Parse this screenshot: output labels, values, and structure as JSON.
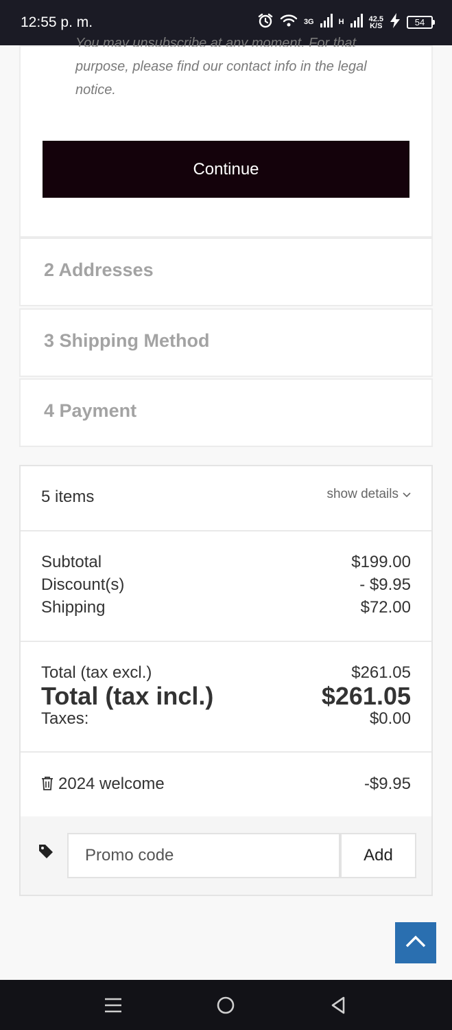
{
  "status_bar": {
    "time": "12:55 p. m.",
    "network_3g": "3G",
    "network_h": "H",
    "speed_value": "42.5",
    "speed_unit": "K/S",
    "battery": "54"
  },
  "consent": {
    "line_partial": "You may unsubscribe at any moment. For that",
    "line2": "purpose, please find our contact info in the legal",
    "line3": "notice.",
    "continue_label": "Continue"
  },
  "steps": [
    {
      "label": "2 Addresses"
    },
    {
      "label": "3 Shipping Method"
    },
    {
      "label": "4 Payment"
    }
  ],
  "cart": {
    "items_count": "5 items",
    "show_details": "show details",
    "subtotal_label": "Subtotal",
    "subtotal_value": "$199.00",
    "discount_label": "Discount(s)",
    "discount_value": "- $9.95",
    "shipping_label": "Shipping",
    "shipping_value": "$72.00",
    "total_excl_label": "Total (tax excl.)",
    "total_excl_value": "$261.05",
    "total_incl_label": "Total (tax incl.)",
    "total_incl_value": "$261.05",
    "taxes_label": "Taxes:",
    "taxes_value": "$0.00",
    "voucher_name": "2024 welcome",
    "voucher_value": "-$9.95",
    "promo_placeholder": "Promo code",
    "add_label": "Add"
  },
  "colors": {
    "continue_bg": "#14020b",
    "scroll_top_bg": "#2a6fb0",
    "step_text": "#a3a3a3"
  }
}
